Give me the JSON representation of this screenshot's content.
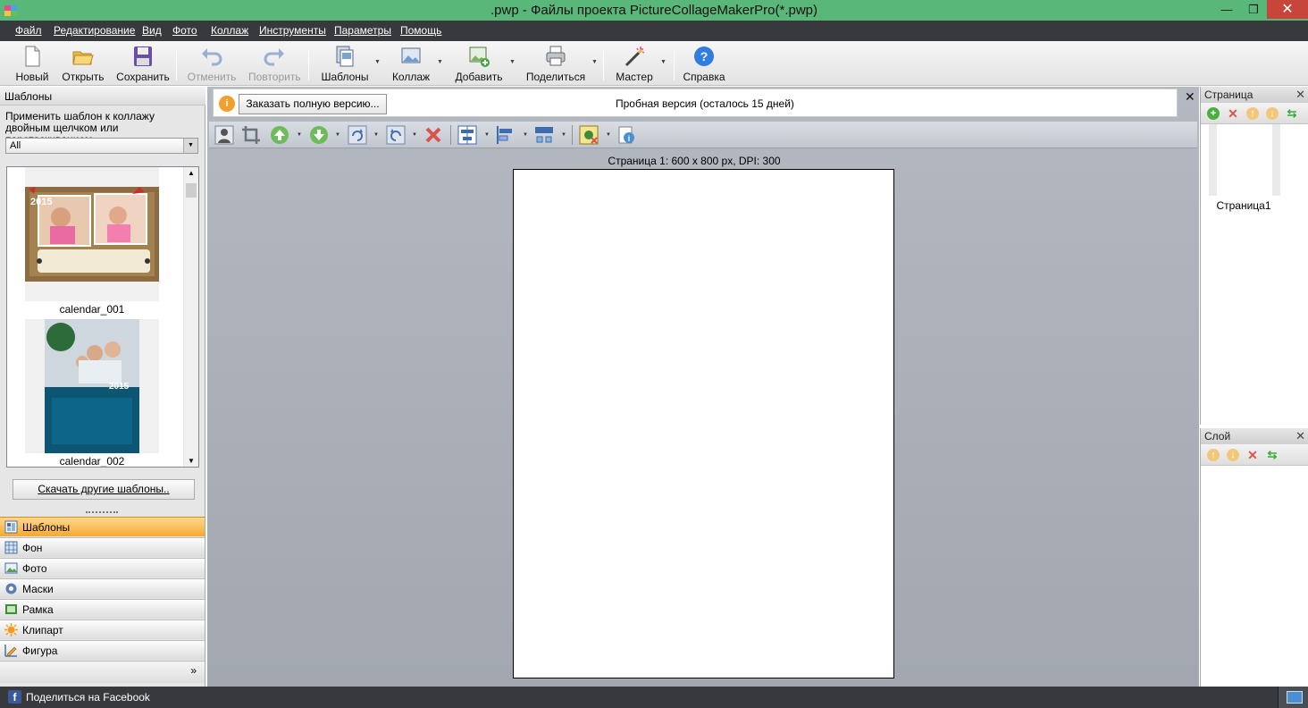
{
  "window": {
    "title": ".pwp - Файлы проекта PictureCollageMakerPro(*.pwp)",
    "minimize": "—",
    "maximize": "❐",
    "close": "✕"
  },
  "menu": [
    "Файл",
    "Редактирование",
    "Вид",
    "Фото",
    "Коллаж",
    "Инструменты",
    "Параметры",
    "Помощь"
  ],
  "toolbar": {
    "new": "Новый",
    "open": "Открыть",
    "save": "Сохранить",
    "undo": "Отменить",
    "redo": "Повторить",
    "templates": "Шаблоны",
    "collage": "Коллаж",
    "add": "Добавить",
    "share": "Поделиться",
    "wizard": "Мастер",
    "help": "Справка"
  },
  "templates_panel": {
    "title": "Шаблоны",
    "hint": "Применить шаблон к коллажу двойным щелчком или перетаскиванием",
    "filter": "All",
    "items": [
      {
        "name": "calendar_001",
        "year": "2015"
      },
      {
        "name": "calendar_002",
        "year": "2015"
      }
    ],
    "more_button": "Скачать другие шаблоны.."
  },
  "nav": {
    "items": [
      "Шаблоны",
      "Фон",
      "Фото",
      "Маски",
      "Рамка",
      "Клипарт",
      "Фигура"
    ],
    "active": "Шаблоны",
    "more": "»"
  },
  "trial": {
    "order_button": "Заказать полную версию...",
    "message": "Пробная версия (осталось 15 дней)",
    "close": "✕"
  },
  "canvas": {
    "page_label": "Страница  1: 600 x 800 px, DPI: 300"
  },
  "page_panel": {
    "title": "Страница",
    "close": "✕",
    "thumb_label": "Страница1"
  },
  "layer_panel": {
    "title": "Слой",
    "close": "✕"
  },
  "status": {
    "share_facebook": "Поделиться на Facebook"
  },
  "colors": {
    "titlebar": "#5ab77a",
    "menubar": "#37393c",
    "active_nav": "#f6a932",
    "close_button": "#c7453a"
  }
}
